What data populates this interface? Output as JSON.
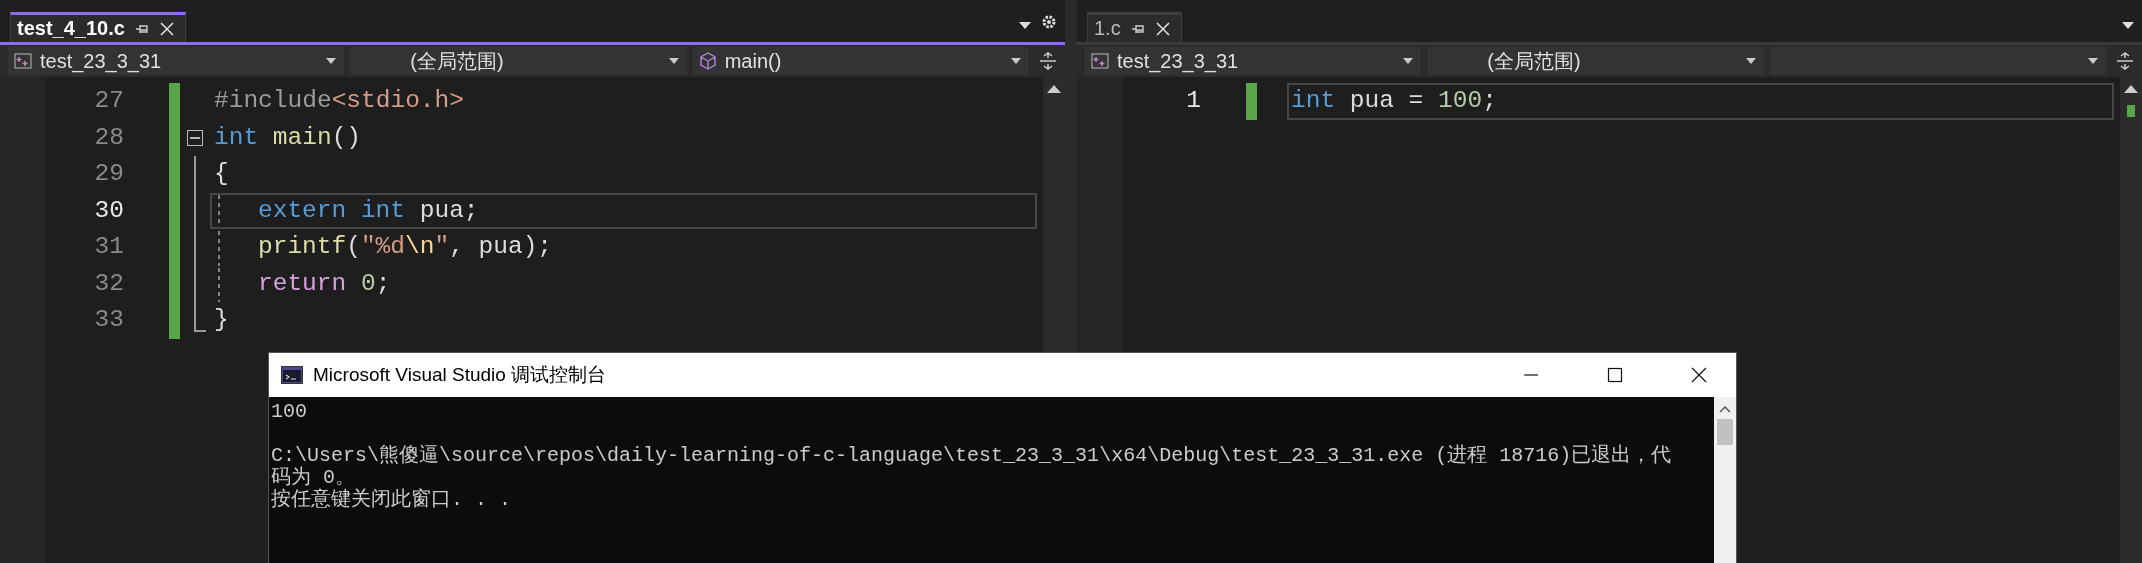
{
  "editors": [
    {
      "active": true,
      "tabs": [
        {
          "label": "test_4_10.c",
          "selected": true
        }
      ],
      "show_settings": true,
      "navbar": [
        {
          "kind": "project",
          "value": "test_23_3_31"
        },
        {
          "kind": "scope",
          "value": "(全局范围)"
        },
        {
          "kind": "function",
          "value": "main()"
        }
      ],
      "lines": [
        {
          "number": "27",
          "changed": true,
          "current": false,
          "indented": false,
          "fold_start": false,
          "fold_body": false,
          "fold_end": false,
          "tokens": [
            {
              "kind": "preproc",
              "text": "#include"
            },
            {
              "kind": "string",
              "text": "<stdio.h>"
            }
          ]
        },
        {
          "number": "28",
          "changed": true,
          "current": false,
          "indented": false,
          "fold_start": true,
          "fold_body": false,
          "fold_end": false,
          "tokens": [
            {
              "kind": "keyword",
              "text": "int "
            },
            {
              "kind": "function",
              "text": "main"
            },
            {
              "kind": "plain",
              "text": "()"
            }
          ]
        },
        {
          "number": "29",
          "changed": true,
          "current": false,
          "indented": false,
          "fold_start": false,
          "fold_body": true,
          "fold_end": false,
          "tokens": [
            {
              "kind": "plain",
              "text": "{"
            }
          ]
        },
        {
          "number": "30",
          "changed": true,
          "current": true,
          "indented": true,
          "fold_start": false,
          "fold_body": true,
          "fold_end": false,
          "tokens": [
            {
              "kind": "keyword",
              "text": "extern "
            },
            {
              "kind": "keyword",
              "text": "int"
            },
            {
              "kind": "plain",
              "text": " pua;"
            }
          ]
        },
        {
          "number": "31",
          "changed": true,
          "current": false,
          "indented": true,
          "fold_start": false,
          "fold_body": true,
          "fold_end": false,
          "tokens": [
            {
              "kind": "function",
              "text": "printf"
            },
            {
              "kind": "plain",
              "text": "("
            },
            {
              "kind": "string",
              "text": "\"%d"
            },
            {
              "kind": "escape",
              "text": "\\n"
            },
            {
              "kind": "string",
              "text": "\""
            },
            {
              "kind": "plain",
              "text": ", pua);"
            }
          ]
        },
        {
          "number": "32",
          "changed": true,
          "current": false,
          "indented": true,
          "fold_start": false,
          "fold_body": true,
          "fold_end": false,
          "tokens": [
            {
              "kind": "control",
              "text": "return "
            },
            {
              "kind": "number",
              "text": "0"
            },
            {
              "kind": "plain",
              "text": ";"
            }
          ]
        },
        {
          "number": "33",
          "changed": true,
          "current": false,
          "indented": false,
          "fold_start": false,
          "fold_body": false,
          "fold_end": true,
          "tokens": [
            {
              "kind": "plain",
              "text": "}"
            }
          ]
        }
      ]
    },
    {
      "active": false,
      "tabs": [
        {
          "label": "1.c",
          "selected": true
        }
      ],
      "show_settings": false,
      "navbar": [
        {
          "kind": "project",
          "value": "test_23_3_31"
        },
        {
          "kind": "scope",
          "value": "(全局范围)"
        },
        {
          "kind": "function"
        }
      ],
      "lines": [
        {
          "number": "1",
          "changed": true,
          "current": true,
          "indented": false,
          "fold_start": false,
          "fold_body": false,
          "fold_end": false,
          "tokens": [
            {
              "kind": "keyword",
              "text": "int"
            },
            {
              "kind": "plain",
              "text": " pua = "
            },
            {
              "kind": "number",
              "text": "100"
            },
            {
              "kind": "plain",
              "text": ";"
            }
          ]
        }
      ]
    }
  ],
  "console": {
    "title": "Microsoft Visual Studio 调试控制台",
    "output_blocks": [
      {
        "lines": [
          "100"
        ]
      },
      {
        "lines": [
          "C:\\Users\\熊傻逼\\source\\repos\\daily-learning-of-c-language\\test_23_3_31\\x64\\Debug\\test_23_3_31.exe (进程 18716)已退出，代",
          "码为 0。",
          "按任意键关闭此窗口. . ."
        ]
      }
    ]
  }
}
